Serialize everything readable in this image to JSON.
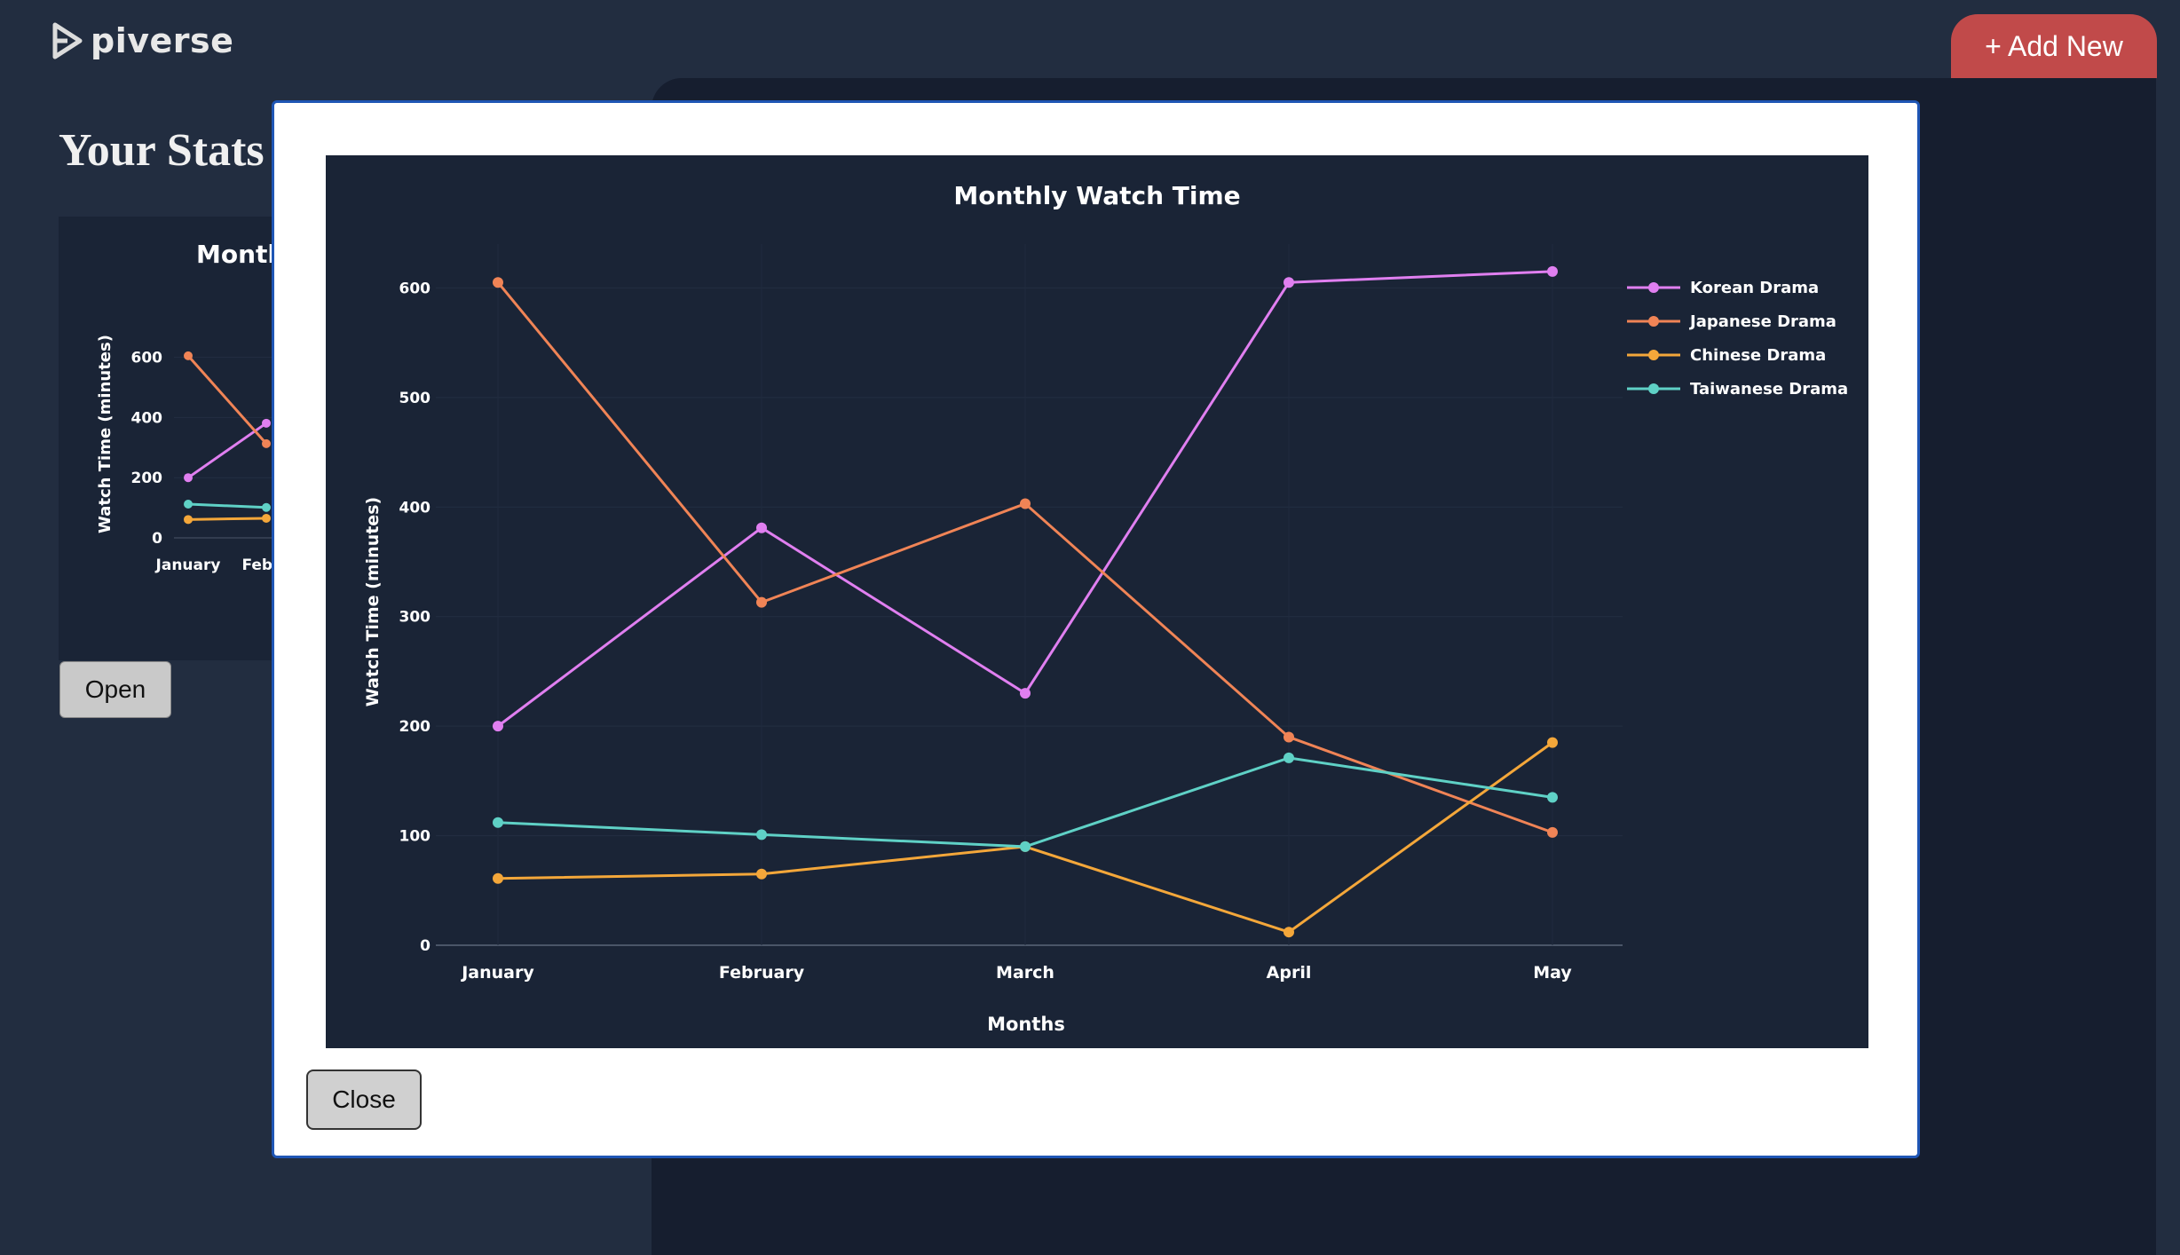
{
  "app": {
    "brand": "piverse",
    "add_button_label": "+ Add New",
    "page_title": "Your Stats"
  },
  "card": {
    "open_label": "Open"
  },
  "modal": {
    "close_label": "Close"
  },
  "colors": {
    "Korean Drama": "#e07ff0",
    "Japanese Drama": "#f08456",
    "Chinese Drama": "#f4a73a",
    "Taiwanese Drama": "#5fd1c6",
    "accent_button": "#c14a4a"
  },
  "chart_data": {
    "type": "line",
    "title": "Monthly Watch Time",
    "xlabel": "Months",
    "ylabel": "Watch Time (minutes)",
    "categories": [
      "January",
      "February",
      "March",
      "April",
      "May"
    ],
    "ylim": [
      0,
      640
    ],
    "yticks": [
      0,
      100,
      200,
      300,
      400,
      500,
      600
    ],
    "legend_position": "top-right",
    "series": [
      {
        "name": "Korean Drama",
        "values": [
          200,
          381,
          230,
          605,
          615
        ]
      },
      {
        "name": "Japanese Drama",
        "values": [
          605,
          313,
          403,
          190,
          103
        ]
      },
      {
        "name": "Chinese Drama",
        "values": [
          61,
          65,
          90,
          12,
          185
        ]
      },
      {
        "name": "Taiwanese Drama",
        "values": [
          112,
          101,
          90,
          171,
          135
        ]
      }
    ],
    "mini": {
      "title_visible": "Montl",
      "yticks": [
        0,
        200,
        400,
        600
      ],
      "categories_visible": [
        "January",
        "Febru"
      ]
    }
  }
}
